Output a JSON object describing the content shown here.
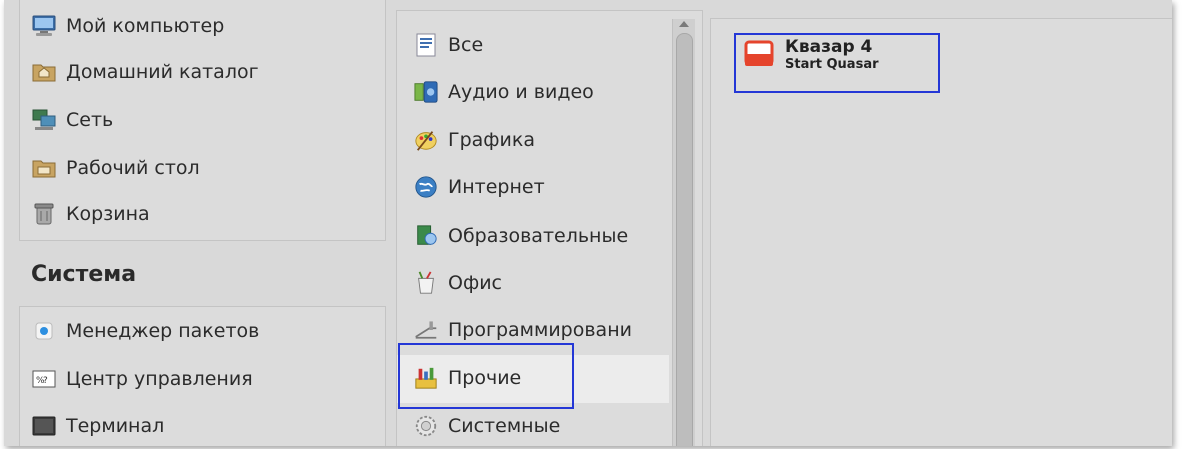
{
  "places": {
    "items": [
      {
        "label": "Мой компьютер",
        "icon": "computer-icon"
      },
      {
        "label": "Домашний каталог",
        "icon": "home-folder-icon"
      },
      {
        "label": "Сеть",
        "icon": "network-icon"
      },
      {
        "label": "Рабочий стол",
        "icon": "desktop-folder-icon"
      },
      {
        "label": "Корзина",
        "icon": "trash-icon"
      }
    ]
  },
  "system": {
    "title": "Система",
    "items": [
      {
        "label": "Менеджер пакетов",
        "icon": "package-manager-icon"
      },
      {
        "label": "Центр управления",
        "icon": "control-center-icon"
      },
      {
        "label": "Терминал",
        "icon": "terminal-icon"
      }
    ]
  },
  "categories": {
    "items": [
      {
        "label": "Все",
        "icon": "all-icon"
      },
      {
        "label": "Аудио и видео",
        "icon": "multimedia-icon"
      },
      {
        "label": "Графика",
        "icon": "graphics-icon"
      },
      {
        "label": "Интернет",
        "icon": "internet-icon"
      },
      {
        "label": "Образовательные",
        "icon": "education-icon"
      },
      {
        "label": "Офис",
        "icon": "office-icon"
      },
      {
        "label": "Программировани",
        "icon": "programming-icon"
      },
      {
        "label": "Прочие",
        "icon": "other-icon"
      },
      {
        "label": "Системные",
        "icon": "system-settings-icon"
      }
    ],
    "selected": "Прочие"
  },
  "apps": {
    "items": [
      {
        "name": "Квазар 4",
        "description": "Start Quasar",
        "icon": "quasar-app-icon"
      }
    ]
  },
  "colors": {
    "highlight": "#2437d6",
    "panel": "#dcdcdc",
    "app_icon": "#e5442c"
  }
}
